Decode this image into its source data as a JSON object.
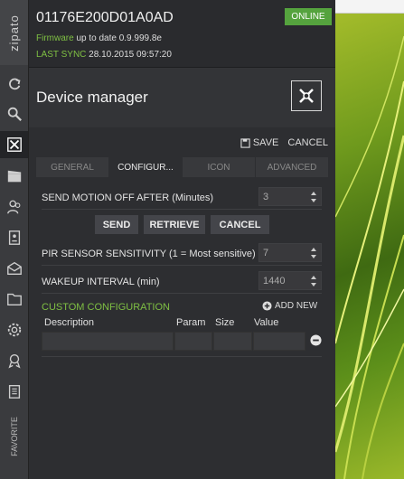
{
  "sidebar": {
    "logo": "zipato",
    "favorite": "FAVORITE",
    "items": [
      {
        "name": "refresh-icon"
      },
      {
        "name": "search-icon"
      },
      {
        "name": "device-manager-icon"
      },
      {
        "name": "scenes-icon"
      },
      {
        "name": "users-icon"
      },
      {
        "name": "contacts-icon"
      },
      {
        "name": "messages-icon"
      },
      {
        "name": "folder-icon"
      },
      {
        "name": "settings-icon"
      },
      {
        "name": "awards-icon"
      },
      {
        "name": "clipboard-icon"
      }
    ]
  },
  "header": {
    "device_id": "01176E200D01A0AD",
    "status": "ONLINE",
    "firmware_label": "Firmware",
    "firmware_text": "up to date 0.9.999.8e",
    "sync_label": "LAST SYNC",
    "sync_text": "28.10.2015 09:57:20"
  },
  "title": "Device manager",
  "actions": {
    "save": "SAVE",
    "cancel": "CANCEL"
  },
  "tabs": [
    "GENERAL",
    "CONFIGUR...",
    "ICON",
    "ADVANCED"
  ],
  "active_tab": "CONFIGUR...",
  "fields": {
    "motion_off": {
      "label": "SEND MOTION OFF AFTER (Minutes)",
      "value": "3"
    },
    "pir": {
      "label": "PIR SENSOR SENSITIVITY (1 = Most sensitive)",
      "value": "7"
    },
    "wakeup": {
      "label": "WAKEUP INTERVAL (min)",
      "value": "1440"
    }
  },
  "buttons": {
    "send": "SEND",
    "retrieve": "RETRIEVE",
    "cancel": "CANCEL"
  },
  "custom": {
    "title": "CUSTOM CONFIGURATION",
    "add_new": "ADD NEW",
    "columns": [
      "Description",
      "Param",
      "Size",
      "Value"
    ]
  },
  "colors": {
    "accent_green": "#7fc043",
    "badge_green": "#55a33e",
    "panel": "#2d2e31"
  }
}
